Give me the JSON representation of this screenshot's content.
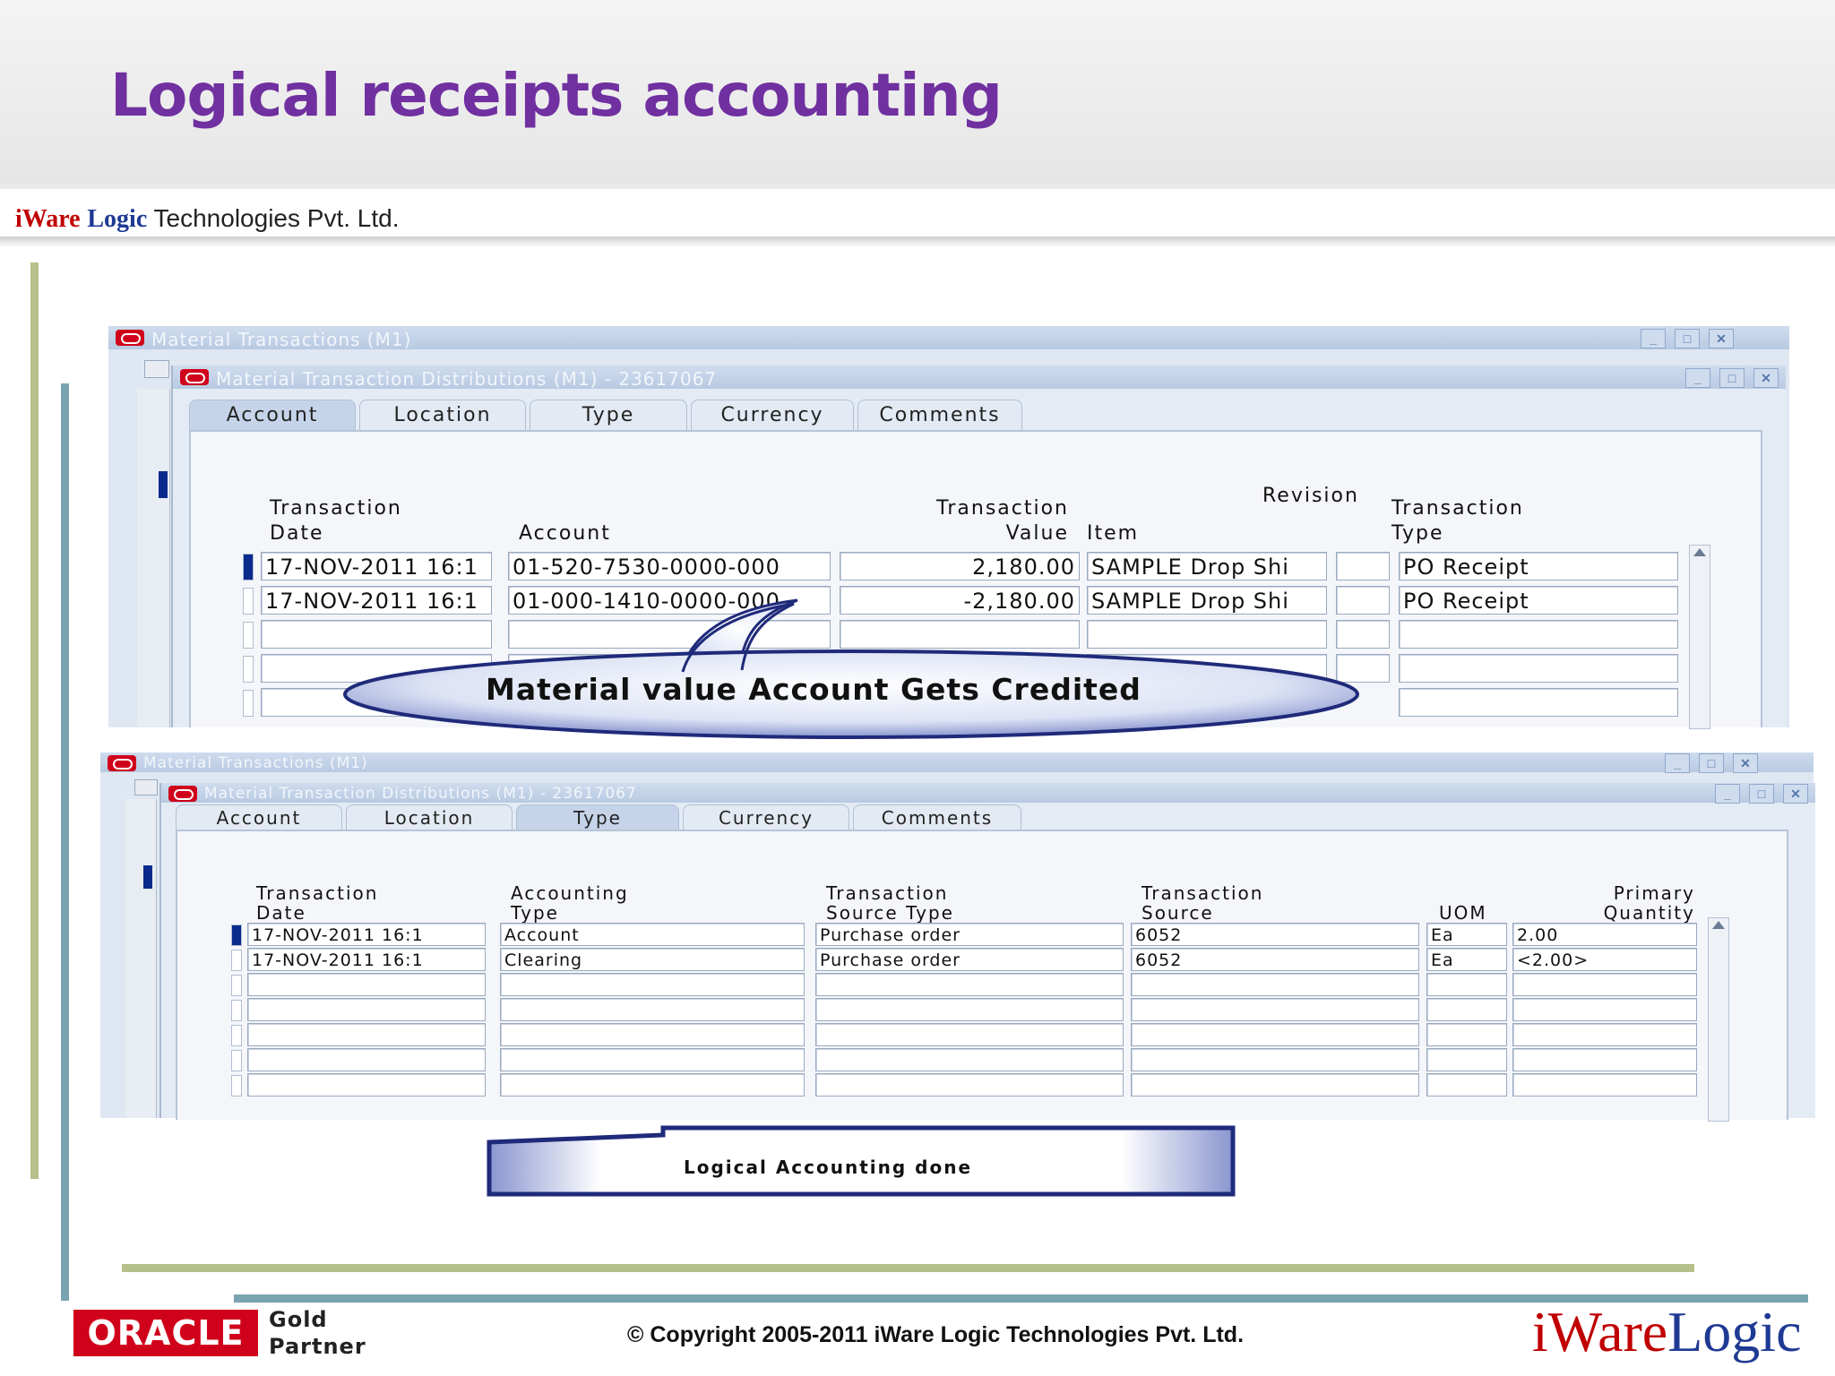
{
  "slide": {
    "title": "Logical receipts accounting",
    "company": {
      "brand_iware": "iWare",
      "brand_logic": "Logic",
      "rest": " Technologies Pvt. Ltd."
    }
  },
  "window1": {
    "outer_title": "Material Transactions (M1)",
    "inner_title": "Material Transaction Distributions (M1) - 23617067",
    "tabs": [
      "Account",
      "Location",
      "Type",
      "Currency",
      "Comments"
    ],
    "active_tab": "Account",
    "headers": {
      "txn_date": [
        "Transaction",
        "Date"
      ],
      "account": "Account",
      "txn_value": [
        "Transaction",
        "Value"
      ],
      "item": "Item",
      "revision": "Revision",
      "txn_type": [
        "Transaction",
        "Type"
      ]
    },
    "rows": [
      {
        "date": "17-NOV-2011 16:1",
        "account": "01-520-7530-0000-000",
        "value": "2,180.00",
        "item": "SAMPLE Drop Shi",
        "revision": "",
        "type": "PO Receipt"
      },
      {
        "date": "17-NOV-2011 16:1",
        "account": "01-000-1410-0000-000",
        "value": "-2,180.00",
        "item": "SAMPLE Drop Shi",
        "revision": "",
        "type": "PO Receipt"
      }
    ],
    "callout": "Material value Account Gets Credited"
  },
  "window2": {
    "outer_title": "Material Transactions (M1)",
    "inner_title": "Material Transaction Distributions (M1) - 23617067",
    "tabs": [
      "Account",
      "Location",
      "Type",
      "Currency",
      "Comments"
    ],
    "active_tab": "Type",
    "headers": {
      "txn_date": [
        "Transaction",
        "Date"
      ],
      "acct_type": [
        "Accounting",
        "Type"
      ],
      "src_type": [
        "Transaction",
        "Source Type"
      ],
      "src": [
        "Transaction",
        "Source"
      ],
      "uom": "UOM",
      "qty": [
        "Primary",
        "Quantity"
      ]
    },
    "rows": [
      {
        "date": "17-NOV-2011 16:1",
        "acct_type": "Account",
        "src_type": "Purchase order",
        "src": "6052",
        "uom": "Ea",
        "qty": "2.00"
      },
      {
        "date": "17-NOV-2011 16:1",
        "acct_type": "Clearing",
        "src_type": "Purchase order",
        "src": "6052",
        "uom": "Ea",
        "qty": "<2.00>"
      }
    ],
    "callout": "Logical Accounting done"
  },
  "footer": {
    "oracle": "ORACLE",
    "gold": "Gold",
    "partner": "Partner",
    "copyright": "© Copyright 2005-2011 iWare Logic Technologies Pvt. Ltd.",
    "logo_iware": "iWare",
    "logo_logic": "Logic"
  },
  "colors": {
    "title": "#7030a0",
    "oracle_red": "#d0021b",
    "bar_green": "#b5c08a",
    "bar_blue": "#7aa3b0",
    "selected_row": "#0a2a8c"
  }
}
